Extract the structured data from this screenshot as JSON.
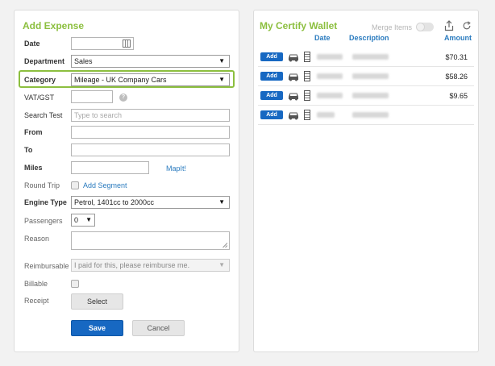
{
  "expense": {
    "title": "Add Expense",
    "labels": {
      "date": "Date",
      "department": "Department",
      "category": "Category",
      "vat": "VAT/GST",
      "search": "Search Test",
      "from": "From",
      "to": "To",
      "miles": "Miles",
      "round_trip": "Round Trip",
      "engine": "Engine Type",
      "passengers": "Passengers",
      "reason": "Reason",
      "reimbursable": "Reimbursable",
      "billable": "Billable",
      "receipt": "Receipt"
    },
    "values": {
      "department": "Sales",
      "category": "Mileage - UK Company Cars",
      "engine": "Petrol, 1401cc to 2000cc",
      "passengers": "0",
      "reimbursable": "I paid for this, please reimburse me."
    },
    "placeholders": {
      "search": "Type to search"
    },
    "links": {
      "mapit": "MapIt!",
      "add_segment": "Add Segment"
    },
    "buttons": {
      "select": "Select",
      "save": "Save",
      "cancel": "Cancel"
    },
    "help_icon": "?"
  },
  "wallet": {
    "title": "My Certify Wallet",
    "merge_label": "Merge Items",
    "columns": {
      "date": "Date",
      "description": "Description",
      "amount": "Amount"
    },
    "rows": [
      {
        "add": "Add",
        "amount": "$70.31"
      },
      {
        "add": "Add",
        "amount": "$58.26"
      },
      {
        "add": "Add",
        "amount": "$9.65"
      },
      {
        "add": "Add",
        "amount": ""
      }
    ],
    "icons": [
      "share-icon",
      "refresh-icon",
      "car-icon",
      "receipt-icon"
    ]
  },
  "colors": {
    "accent_green": "#8cbf3f",
    "link_blue": "#2a7bbf",
    "button_blue": "#1768c2"
  }
}
